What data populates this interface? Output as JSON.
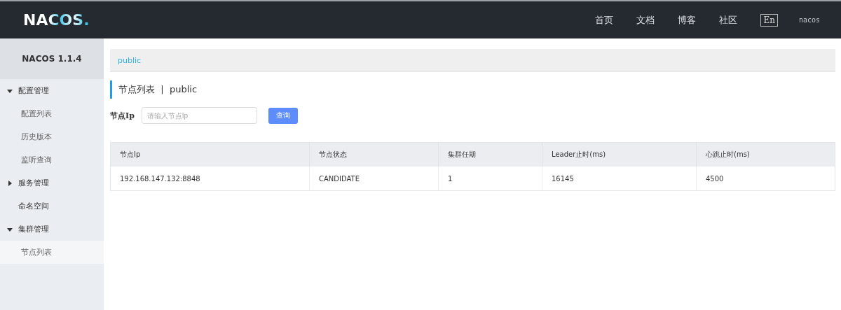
{
  "header": {
    "logo": "NACOS.",
    "nav": [
      {
        "label": "首页"
      },
      {
        "label": "文档"
      },
      {
        "label": "博客"
      },
      {
        "label": "社区"
      }
    ],
    "language": "En",
    "user": "nacos"
  },
  "sidebar": {
    "title": "NACOS 1.1.4",
    "items": [
      {
        "label": "配置管理",
        "kind": "group",
        "expanded": true,
        "children": [
          {
            "label": "配置列表",
            "selected": false
          },
          {
            "label": "历史版本",
            "selected": false
          },
          {
            "label": "监听查询",
            "selected": false
          }
        ]
      },
      {
        "label": "服务管理",
        "kind": "group",
        "expanded": false
      },
      {
        "label": "命名空间",
        "kind": "link"
      },
      {
        "label": "集群管理",
        "kind": "group",
        "expanded": true,
        "children": [
          {
            "label": "节点列表",
            "selected": true
          }
        ]
      }
    ]
  },
  "namespace_bar": {
    "namespace": "public"
  },
  "page_title": {
    "title": "节点列表",
    "separator": "|",
    "namespace": "public"
  },
  "search": {
    "label": "节点Ip",
    "placeholder": "请输入节点Ip",
    "button": "查询"
  },
  "table": {
    "columns": [
      "节点Ip",
      "节点状态",
      "集群任期",
      "Leader止时(ms)",
      "心跳止时(ms)"
    ],
    "rows": [
      [
        "192.168.147.132:8848",
        "CANDIDATE",
        "1",
        "16145",
        "4500"
      ]
    ]
  }
}
